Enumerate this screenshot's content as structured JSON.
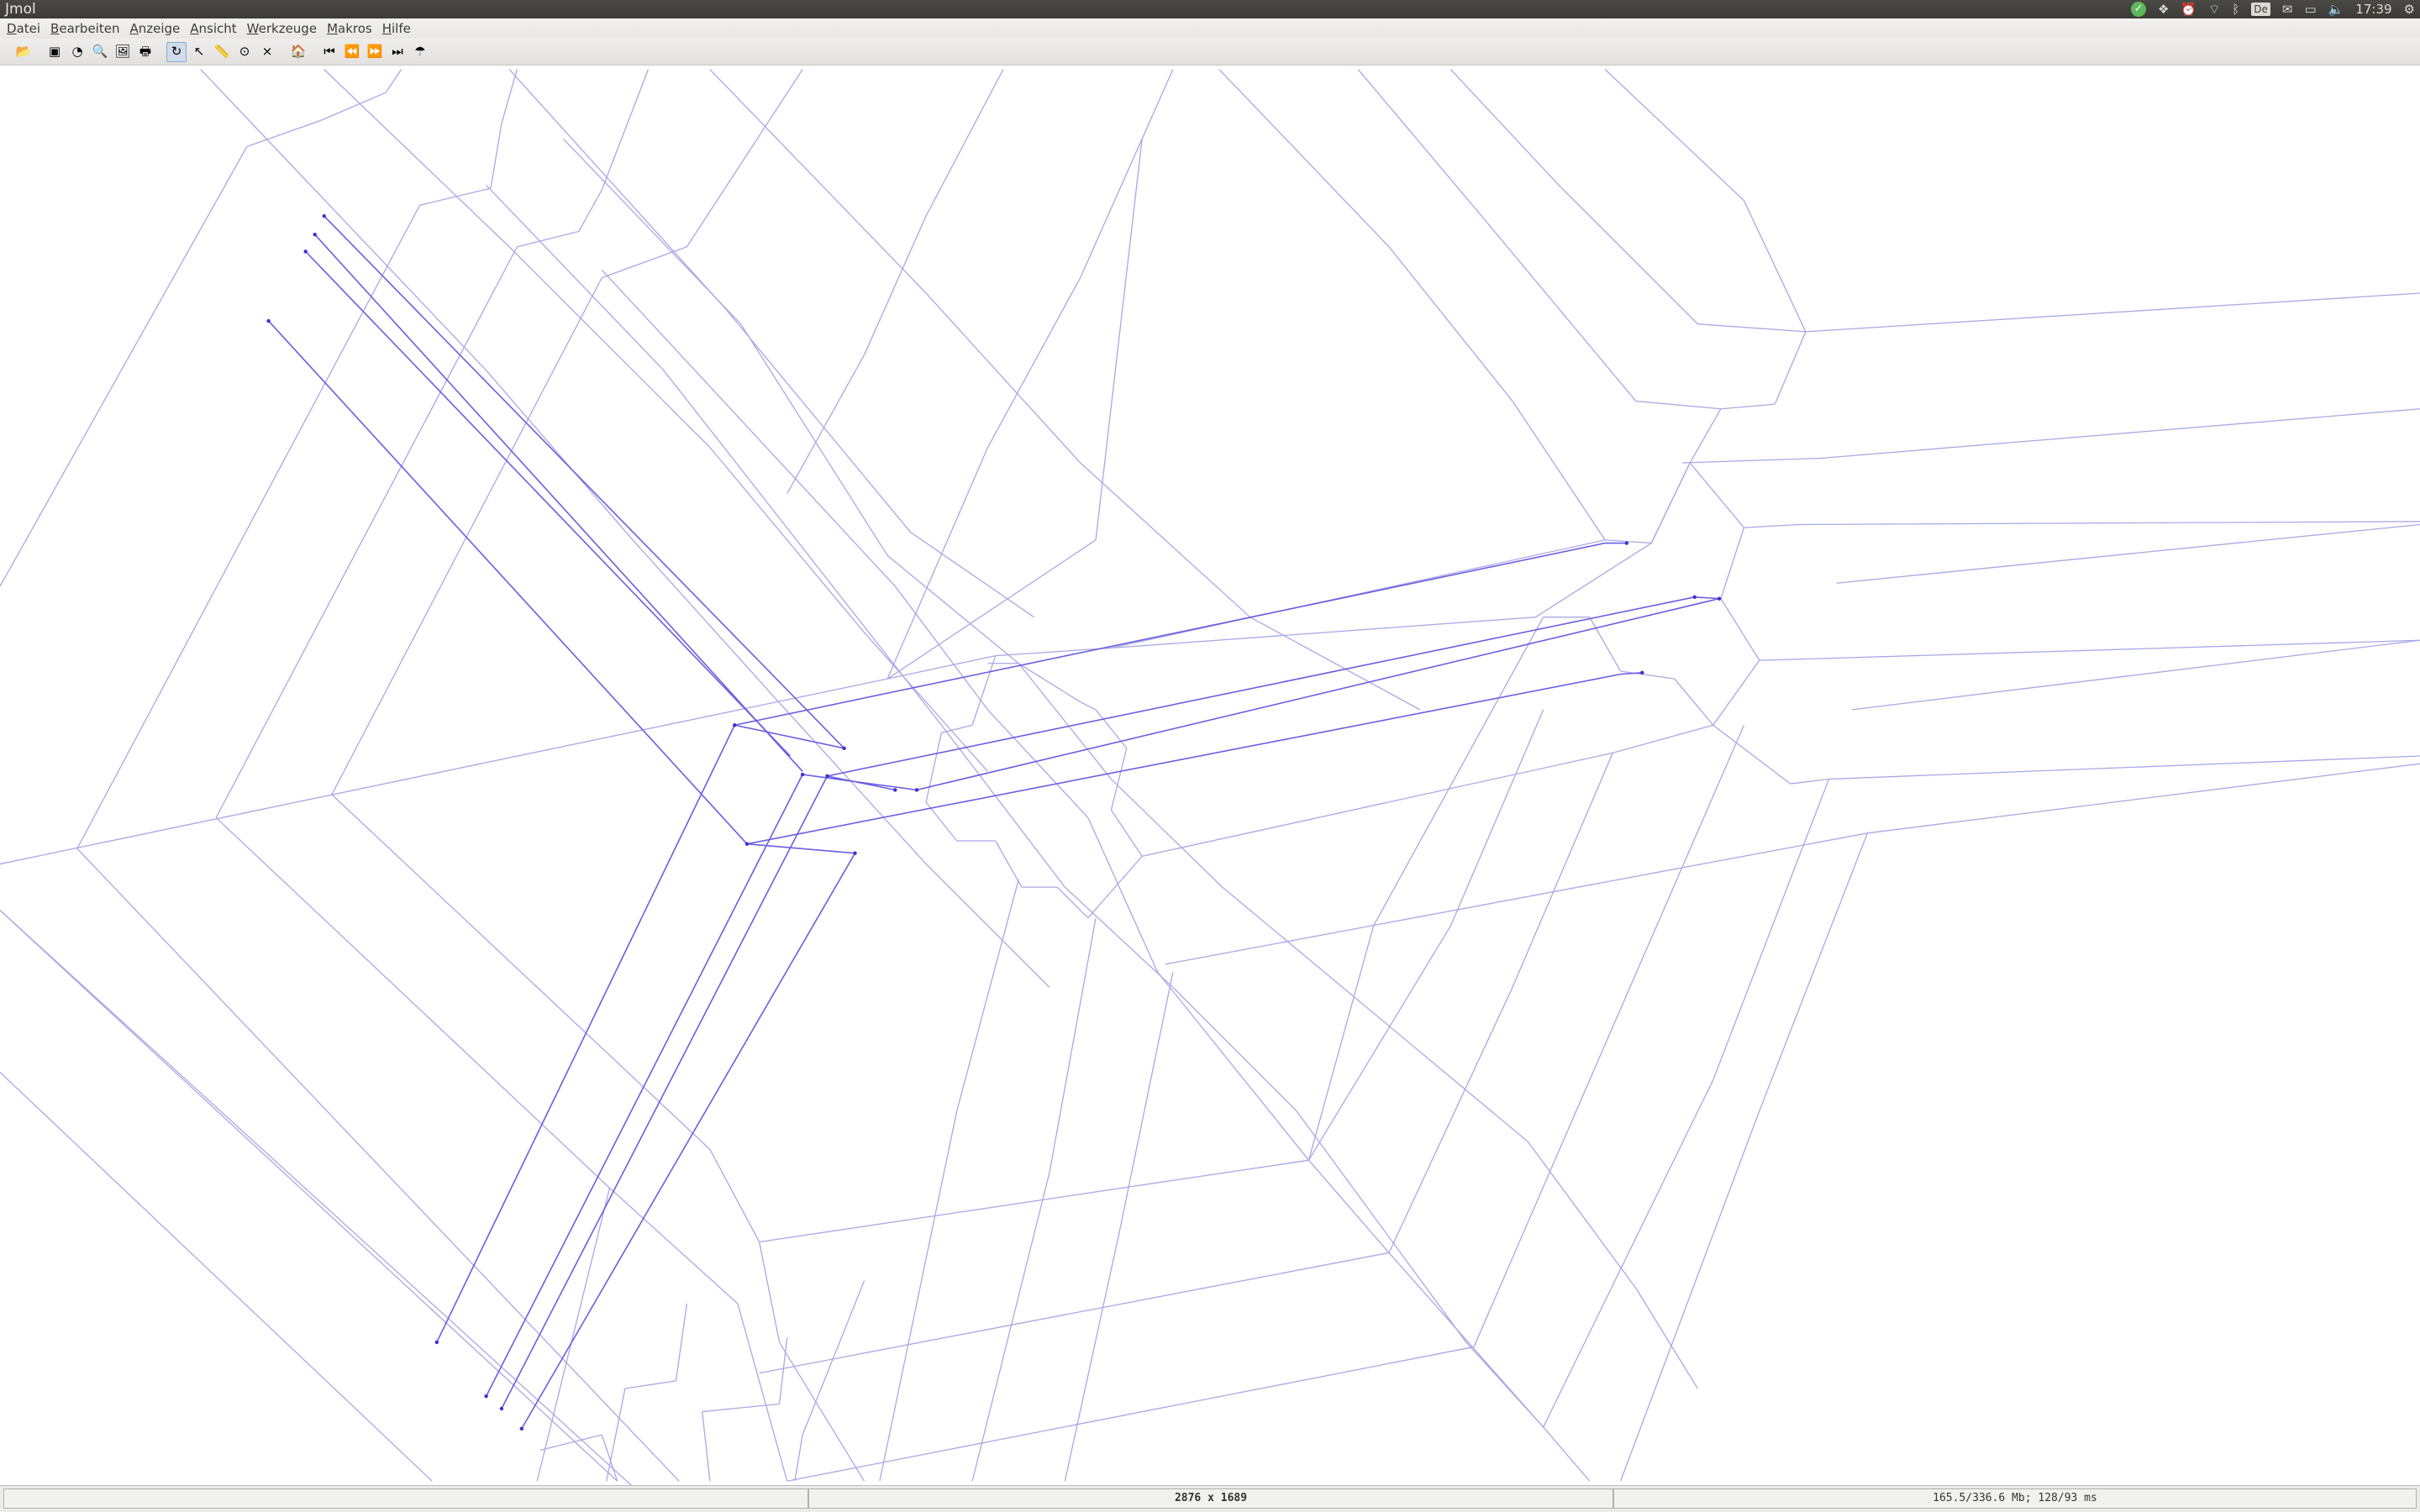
{
  "window": {
    "title": "Jmol"
  },
  "system_tray": {
    "icons": [
      "checkmark-icon",
      "dropbox-icon",
      "alarm-icon",
      "wifi-icon",
      "bluetooth-icon",
      "mail-icon",
      "battery-icon",
      "volume-icon",
      "settings-gear-icon"
    ],
    "keyboard_layout": "De",
    "clock": "17:39"
  },
  "menu": {
    "items": [
      "Datei",
      "Bearbeiten",
      "Anzeige",
      "Ansicht",
      "Werkzeuge",
      "Makros",
      "Hilfe"
    ]
  },
  "toolbar": {
    "buttons": [
      {
        "name": "open-file-icon",
        "glyph": "📂"
      },
      {
        "name": "script-console-icon",
        "glyph": "▣"
      },
      {
        "name": "preferences-icon",
        "glyph": "◔"
      },
      {
        "name": "find-icon",
        "glyph": "🔍"
      },
      {
        "name": "export-image-icon",
        "glyph": "🖼"
      },
      {
        "name": "print-icon",
        "glyph": "🖶"
      },
      {
        "name": "rotate-icon",
        "glyph": "↻",
        "active": true
      },
      {
        "name": "pick-cursor-icon",
        "glyph": "↖"
      },
      {
        "name": "measure-ruler-icon",
        "glyph": "📏"
      },
      {
        "name": "spin-search-icon",
        "glyph": "⊙"
      },
      {
        "name": "cross-select-icon",
        "glyph": "⨯"
      },
      {
        "name": "home-view-icon",
        "glyph": "🏠"
      },
      {
        "name": "first-frame-icon",
        "glyph": "⏮"
      },
      {
        "name": "previous-frame-icon",
        "glyph": "⏪"
      },
      {
        "name": "play-icon",
        "glyph": "⏩"
      },
      {
        "name": "last-frame-icon",
        "glyph": "⏭"
      },
      {
        "name": "about-icon",
        "glyph": "☂"
      }
    ]
  },
  "viewer": {
    "line_color": "#a8a8e6",
    "highlight_color": "#6a5fe0",
    "dot_color": "#3b2fd6"
  },
  "status": {
    "left": "",
    "center": "2876 x 1689",
    "right": "165.5/336.6 Mb; 128/93 ms"
  }
}
